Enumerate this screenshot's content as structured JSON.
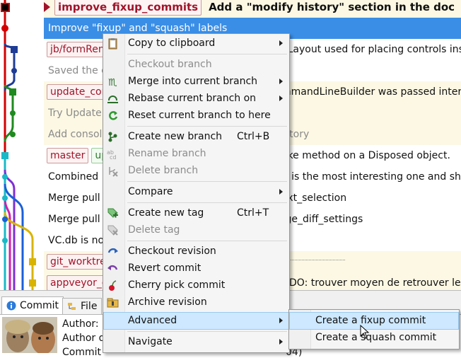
{
  "commits": [
    {
      "branch": "improve_fixup_commits",
      "message": "Add a \"modify history\" section in the doc"
    },
    {
      "message": "Improve \"fixup\" and \"squash\" labels"
    },
    {
      "branch": "jb/formRen",
      "tail": "eLayout used for placing controls insi"
    },
    {
      "message": "Saved the c"
    },
    {
      "branch": "update_cor",
      "tail": "mmandLineBuilder was passed intern"
    },
    {
      "message": "Try Update"
    },
    {
      "message": "Add consol",
      "tail": "sitory"
    },
    {
      "branch": "master",
      "branch2": "up",
      "tail": "oke method on a Disposed object."
    },
    {
      "message": "Combined",
      "tail": "ff is the most interesting one and sho"
    },
    {
      "message": "Merge pull",
      "tail": "ext_selection"
    },
    {
      "message": "Merge pull",
      "tail": "rge_diff_settings"
    },
    {
      "message": "VC.db is no"
    },
    {
      "branch": "git_worktre"
    },
    {
      "branch": "appveyor_c",
      "tail": "ODO: trouver moyen de retrouver le"
    }
  ],
  "context_menu": {
    "items": [
      {
        "label": "Copy to clipboard",
        "icon": "clipboard-icon",
        "submenu": true
      },
      {
        "label": "Checkout branch",
        "disabled": true
      },
      {
        "label": "Merge into current branch",
        "icon": "merge-icon",
        "submenu": true
      },
      {
        "label": "Rebase current branch on",
        "icon": "rebase-icon",
        "submenu": true
      },
      {
        "label": "Reset current branch to here",
        "icon": "reset-icon"
      },
      {
        "label": "Create new branch",
        "icon": "new-branch-icon",
        "shortcut": "Ctrl+B"
      },
      {
        "label": "Rename branch",
        "icon": "rename-branch-icon",
        "disabled": true
      },
      {
        "label": "Delete branch",
        "icon": "delete-branch-icon",
        "disabled": true
      },
      {
        "label": "Compare",
        "submenu": true
      },
      {
        "label": "Create new tag",
        "icon": "new-tag-icon",
        "shortcut": "Ctrl+T"
      },
      {
        "label": "Delete tag",
        "icon": "delete-tag-icon",
        "disabled": true
      },
      {
        "label": "Checkout revision",
        "icon": "checkout-revision-icon"
      },
      {
        "label": "Revert commit",
        "icon": "revert-icon"
      },
      {
        "label": "Cherry pick commit",
        "icon": "cherry-icon"
      },
      {
        "label": "Archive revision",
        "icon": "archive-icon"
      },
      {
        "label": "Advanced",
        "submenu": true
      },
      {
        "label": "Navigate",
        "submenu": true
      }
    ],
    "submenu": [
      {
        "label": "Create a fixup commit"
      },
      {
        "label": "Create a squash commit"
      }
    ]
  },
  "tabs": {
    "commit": "Commit",
    "file": "File"
  },
  "details": {
    "author_label": "Author:",
    "author_date_label": "Author d",
    "committer_label": "Commit",
    "date_fragment": "04)"
  },
  "colors": {
    "selection": "#3a8ee6",
    "menu_hover": "#cde8ff",
    "branch_text": "#a0142a"
  }
}
